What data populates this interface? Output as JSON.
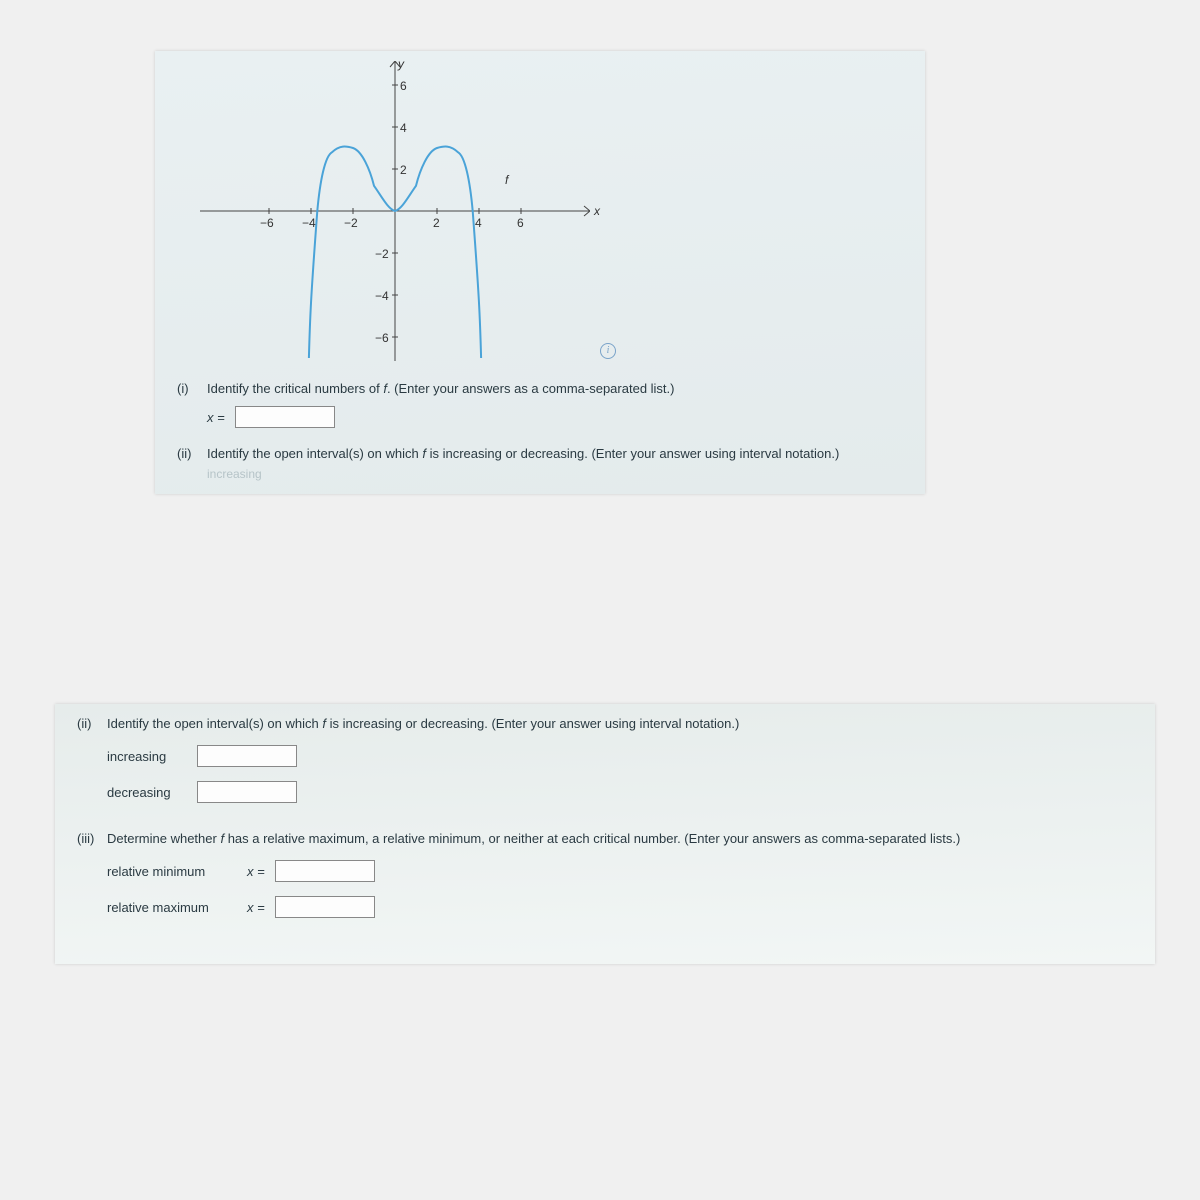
{
  "chart_data": {
    "type": "line",
    "title": "",
    "xlabel": "x",
    "ylabel": "y",
    "function_label": "f",
    "xlim": [
      -7,
      7
    ],
    "ylim": [
      -7,
      7
    ],
    "x_ticks": [
      -6,
      -4,
      -2,
      2,
      4,
      6
    ],
    "y_ticks": [
      -6,
      -4,
      -2,
      2,
      4,
      6
    ],
    "series": [
      {
        "name": "f",
        "color": "#4aa3d8",
        "points": [
          {
            "x": -4.1,
            "y": -7
          },
          {
            "x": -4,
            "y": -4
          },
          {
            "x": -3.7,
            "y": 0
          },
          {
            "x": -3,
            "y": 2.8
          },
          {
            "x": -2,
            "y": 3.0
          },
          {
            "x": -1,
            "y": 1.2
          },
          {
            "x": 0,
            "y": 0
          },
          {
            "x": 1,
            "y": 1.2
          },
          {
            "x": 2,
            "y": 3.0
          },
          {
            "x": 3,
            "y": 2.8
          },
          {
            "x": 3.7,
            "y": 0
          },
          {
            "x": 4,
            "y": -4
          },
          {
            "x": 4.1,
            "y": -7
          }
        ]
      }
    ]
  },
  "questions": {
    "q1": {
      "num": "(i)",
      "text_pre": "Identify the critical numbers of ",
      "fn": "f",
      "text_post": ". (Enter your answers as a comma-separated list.)",
      "answer_label": "x ="
    },
    "q2": {
      "num": "(ii)",
      "text_pre": "Identify the open interval(s) on which ",
      "fn": "f",
      "text_post": " is increasing or decreasing. (Enter your answer using interval notation.)",
      "cut_label": "increasing"
    },
    "q2b": {
      "num": "(ii)",
      "text_pre": "Identify the open interval(s) on which ",
      "fn": "f",
      "text_post": " is increasing or decreasing. (Enter your answer using interval notation.)",
      "inc_label": "increasing",
      "dec_label": "decreasing"
    },
    "q3": {
      "num": "(iii)",
      "text_pre": "Determine whether ",
      "fn": "f",
      "text_post": " has a relative maximum, a relative minimum, or neither at each critical number. (Enter your answers as comma-separated lists.)",
      "min_label": "relative minimum",
      "max_label": "relative maximum",
      "eq": "x ="
    }
  },
  "info_glyph": "i"
}
